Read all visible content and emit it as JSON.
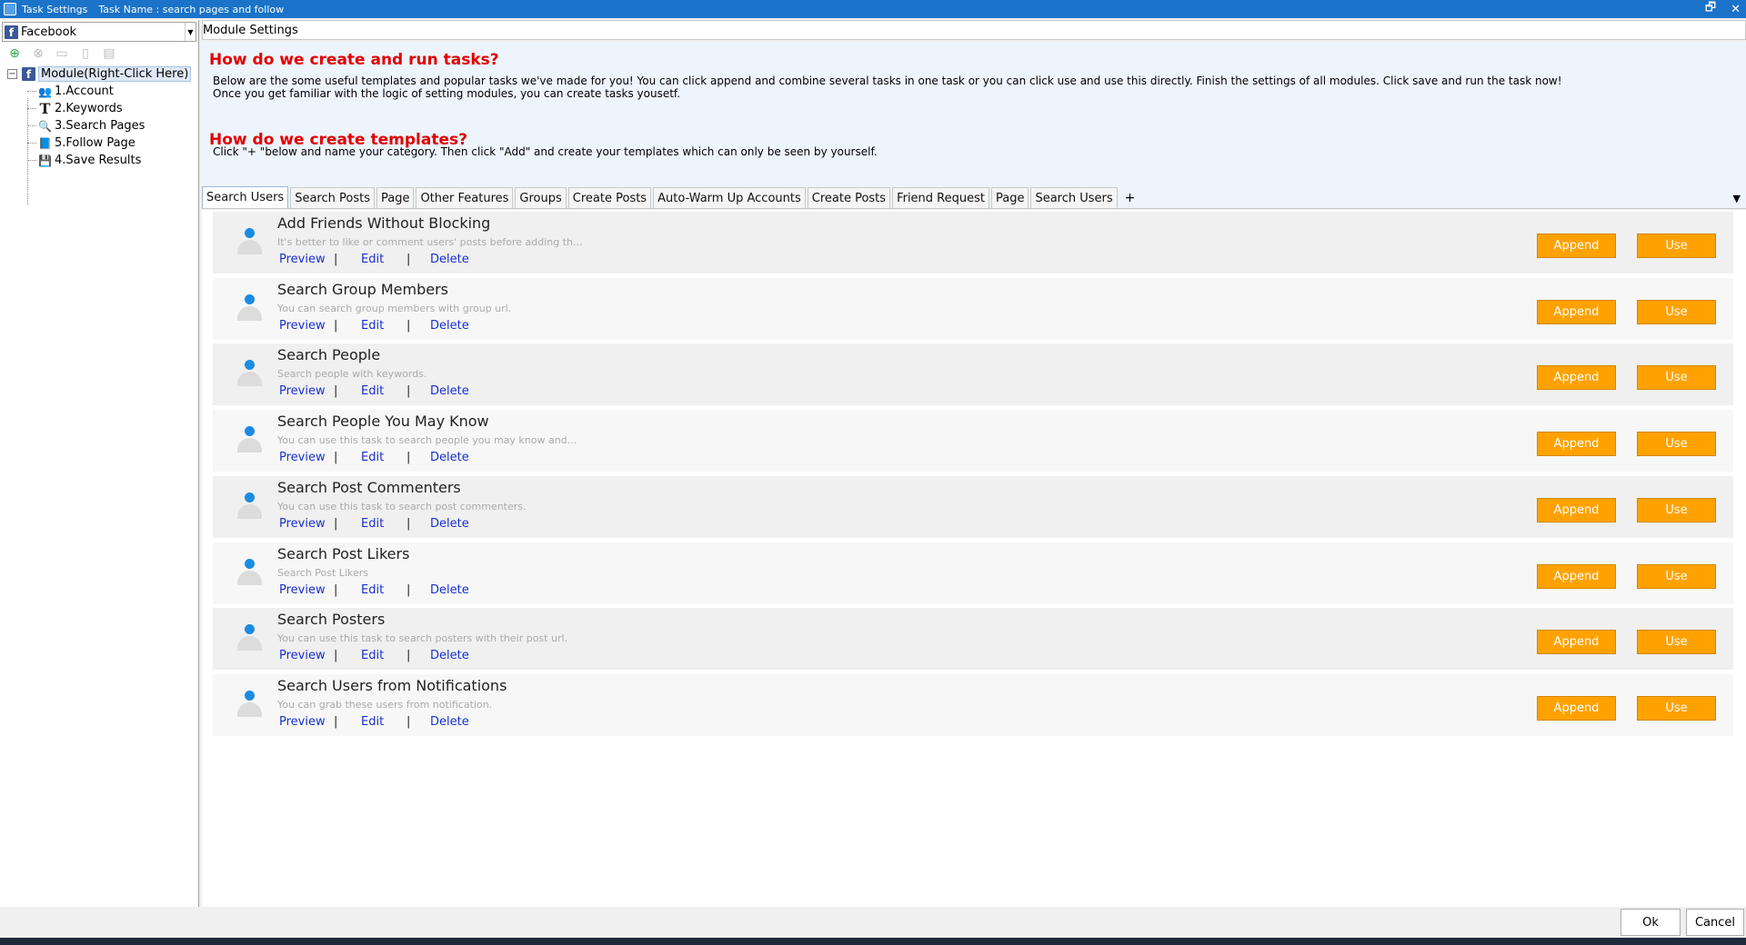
{
  "window": {
    "title": "Task Settings",
    "task_name": "Task Name : search pages and follow",
    "restore_glyph": "🗗",
    "close_glyph": "✕"
  },
  "left": {
    "platform": "Facebook",
    "platform_icon": "f",
    "tree": {
      "root_label": "Module(Right-Click Here)",
      "collapse_glyph": "−",
      "items": [
        {
          "label": "1.Account",
          "icon": "people-icon",
          "glyph": "👥",
          "color": "#d98a1a"
        },
        {
          "label": "2.Keywords",
          "icon": "text-icon",
          "glyph": "T",
          "color": "#222222"
        },
        {
          "label": "3.Search Pages",
          "icon": "magnifier-icon",
          "glyph": "🔍",
          "color": "#2c7fd0"
        },
        {
          "label": "5.Follow Page",
          "icon": "book-icon",
          "glyph": "📘",
          "color": "#1b6ab8"
        },
        {
          "label": "4.Save Results",
          "icon": "floppy-disk-icon",
          "glyph": "💾",
          "color": "#333333"
        }
      ]
    }
  },
  "module": {
    "header": "Module Settings",
    "info": {
      "heading1": "How do we create and run tasks?",
      "text1": "Below are the some useful templates and popular tasks we've made for you!  You can click append and combine several tasks in one task or you can click use and use this directly. Finish the settings of all modules. Click save and run the task now!",
      "text1b": "Once you get familiar with the logic of setting modules, you can create tasks yousetf.",
      "heading2": "How do we create templates?",
      "text2": "Click \"+ \"below and name your category. Then click \"Add\" and create your templates which can only be seen by yourself."
    },
    "tabs": [
      "Search Users",
      "Search Posts",
      "Page",
      "Other Features",
      "Groups",
      "Create Posts",
      "Auto-Warm Up  Accounts",
      "Create Posts",
      "Friend Request",
      "Page",
      "Search Users"
    ],
    "tab_add": "+",
    "tab_menu": "▼"
  },
  "templates": {
    "link_preview": "Preview",
    "link_edit": "Edit",
    "link_delete": "Delete",
    "separator": "|",
    "append_label": "Append",
    "use_label": "Use",
    "items": [
      {
        "title": "Add Friends Without Blocking",
        "desc": "It's better to like or comment users' posts before adding th..."
      },
      {
        "title": "Search Group Members",
        "desc": "You can search group members with group url."
      },
      {
        "title": "Search People",
        "desc": "Search people with keywords."
      },
      {
        "title": "Search People You May Know",
        "desc": "You can use this task to search people you may know and..."
      },
      {
        "title": "Search Post Commenters",
        "desc": "You can use this task to search post commenters."
      },
      {
        "title": "Search Post Likers",
        "desc": "Search Post Likers"
      },
      {
        "title": "Search Posters",
        "desc": "You can use this task to search posters with their post url."
      },
      {
        "title": "Search Users from Notifications",
        "desc": "You can grab these users from notification."
      }
    ]
  },
  "footer": {
    "ok_label": "Ok",
    "cancel_label": "Cancel"
  },
  "colors": {
    "titlebar": "#1a73c8",
    "accent_button": "#ffa200",
    "heading_red": "#e00000",
    "link_blue": "#1a2fd0"
  }
}
